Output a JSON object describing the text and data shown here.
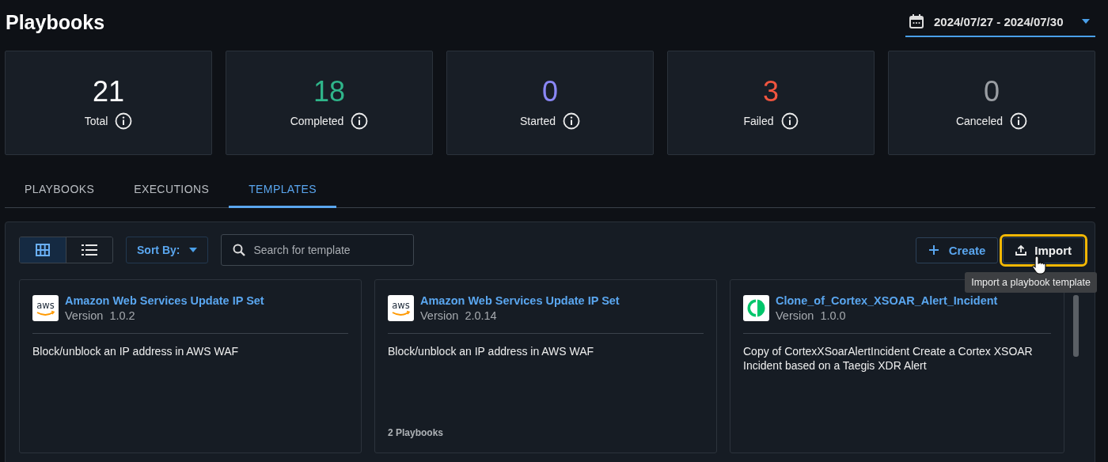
{
  "page": {
    "title": "Playbooks"
  },
  "date_range": {
    "value": "2024/07/27 - 2024/07/30"
  },
  "stats": [
    {
      "value": "21",
      "label": "Total",
      "color": "#ffffff"
    },
    {
      "value": "18",
      "label": "Completed",
      "color": "#2fb58a"
    },
    {
      "value": "0",
      "label": "Started",
      "color": "#8a87f5"
    },
    {
      "value": "3",
      "label": "Failed",
      "color": "#f0553f"
    },
    {
      "value": "0",
      "label": "Canceled",
      "color": "#9a9ea3"
    }
  ],
  "tabs": [
    {
      "label": "PLAYBOOKS",
      "selected": false
    },
    {
      "label": "EXECUTIONS",
      "selected": false
    },
    {
      "label": "TEMPLATES",
      "selected": true
    }
  ],
  "toolbar": {
    "views": [
      {
        "kind": "grid",
        "selected": true
      },
      {
        "kind": "list",
        "selected": false
      }
    ],
    "sort": {
      "label": "Sort By:"
    },
    "search": {
      "placeholder": "Search for template"
    },
    "create": {
      "label": "Create"
    },
    "import": {
      "label": "Import",
      "highlighted": true,
      "tooltip": "Import a playbook template"
    }
  },
  "templates": [
    {
      "kind": "aws",
      "logo_text": "aws",
      "title": "Amazon Web Services Update IP Set",
      "version_label": "Version",
      "version": "1.0.2",
      "description": "Block/unblock an IP address in AWS WAF"
    },
    {
      "kind": "aws",
      "logo_text": "aws",
      "title": "Amazon Web Services Update IP Set",
      "version_label": "Version",
      "version": "2.0.14",
      "description": "Block/unblock an IP address in AWS WAF",
      "footer": "2 Playbooks"
    },
    {
      "kind": "cortex",
      "title": "Clone_of_Cortex_XSOAR_Alert_Incident",
      "version_label": "Version",
      "version": "1.0.0",
      "description": "Copy of CortexXSoarAlertIncident Create a Cortex XSOAR Incident based on a Taegis XDR Alert"
    }
  ]
}
